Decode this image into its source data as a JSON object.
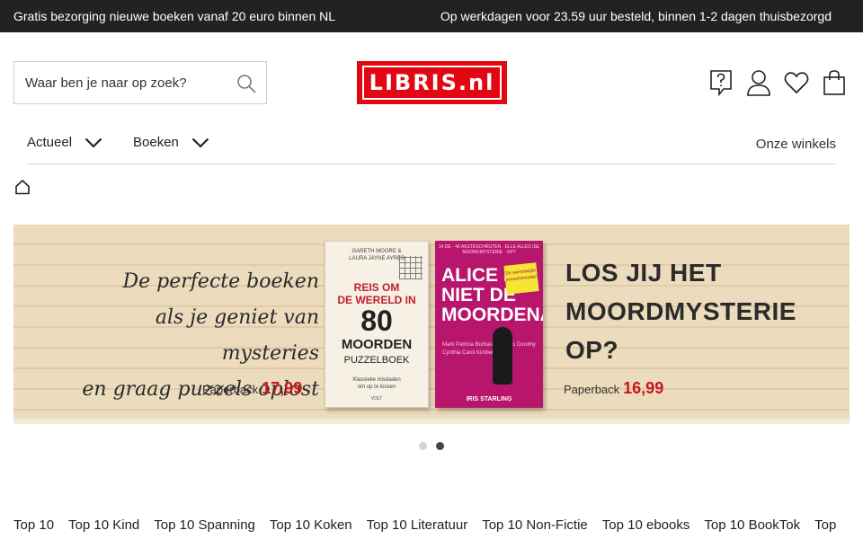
{
  "topbar": {
    "left": "Gratis bezorging nieuwe boeken vanaf 20 euro binnen NL",
    "right": "Op werkdagen voor 23.59 uur besteld, binnen 1-2 dagen thuisbezorgd"
  },
  "search": {
    "placeholder": "Waar ben je naar op zoek?"
  },
  "logo": {
    "text": "LIBRIS.nl",
    "color": "#e30613"
  },
  "header_icons": [
    "help-icon",
    "account-icon",
    "heart-icon",
    "shopping-bag-icon"
  ],
  "nav": {
    "items": [
      {
        "label": "Actueel"
      },
      {
        "label": "Boeken"
      }
    ],
    "stores": "Onze winkels"
  },
  "banner": {
    "tagline": [
      "De perfecte boeken",
      "als je geniet van mysteries",
      "en graag puzzels oplost"
    ],
    "price_left_label": "Paperback",
    "price_left": "17,99",
    "headline": [
      "LOS JIJ HET",
      "MOORDMYSTERIE",
      "OP?"
    ],
    "price_right_label": "Paperback",
    "price_right": "16,99",
    "book1": {
      "authors": [
        "GARETH MOORE &",
        "LAURA JAYNE AYRES"
      ],
      "title_1": [
        "REIS OM",
        "DE WERELD IN"
      ],
      "title_2": "80",
      "title_3": "MOORDEN",
      "title_4": "PUZZELBOEK",
      "subtitle": [
        "Klassieke misdaden",
        "om op te lossen"
      ],
      "publisher": "VOLT"
    },
    "book2": {
      "topline": "14 DE · 46 AKSTESCHRIJTEN · ELLE ALLES ISE MOORDMYSTERIE · OP?",
      "title": [
        "ALICE IS",
        "NIET DE",
        "MOORDENAAR"
      ],
      "sticker": [
        "De wereldwijde",
        "puzzelsensatie!"
      ],
      "names": "Mark Patricia Burbara Thomas Dorothy Cynthia Carol Kimberly Tyler",
      "author": "IRIS STARLING"
    },
    "slide_count": 2,
    "active_slide": 2
  },
  "tops": [
    "Top 10",
    "Top 10 Kind",
    "Top 10 Spanning",
    "Top 10 Koken",
    "Top 10 Literatuur",
    "Top 10 Non-Fictie",
    "Top 10 ebooks",
    "Top 10 BookTok",
    "Top"
  ]
}
